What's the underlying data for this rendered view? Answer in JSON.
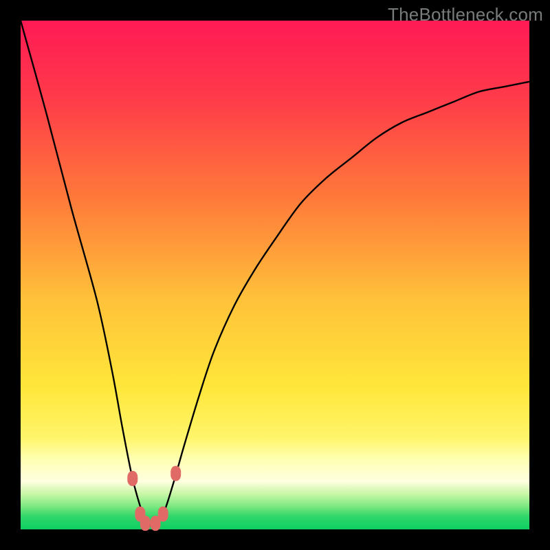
{
  "watermark": "TheBottleneck.com",
  "chart_data": {
    "type": "line",
    "title": "",
    "xlabel": "",
    "ylabel": "",
    "xlim": [
      0,
      100
    ],
    "ylim": [
      0,
      100
    ],
    "series": [
      {
        "name": "bottleneck-curve",
        "x": [
          0,
          5,
          10,
          15,
          18,
          20,
          22,
          24,
          25,
          26,
          28,
          30,
          32,
          35,
          38,
          42,
          46,
          50,
          55,
          60,
          65,
          70,
          75,
          80,
          85,
          90,
          95,
          100
        ],
        "values": [
          100,
          82,
          63,
          45,
          31,
          20,
          10,
          3,
          1,
          1,
          3,
          9,
          16,
          26,
          35,
          44,
          51,
          57,
          64,
          69,
          73,
          77,
          80,
          82,
          84,
          86,
          87,
          88
        ]
      }
    ],
    "markers": [
      {
        "name": "marker-left-upper",
        "x": 22.0,
        "y": 10.0
      },
      {
        "name": "marker-left-lower",
        "x": 23.5,
        "y": 3.0
      },
      {
        "name": "marker-bottom-left",
        "x": 24.5,
        "y": 1.2
      },
      {
        "name": "marker-bottom-right",
        "x": 26.5,
        "y": 1.2
      },
      {
        "name": "marker-right-lower",
        "x": 28.0,
        "y": 3.0
      },
      {
        "name": "marker-right-upper",
        "x": 30.5,
        "y": 11.0
      }
    ],
    "gradient_stops": [
      {
        "pos": 0.0,
        "color": "#ff1a55"
      },
      {
        "pos": 0.15,
        "color": "#ff3a4a"
      },
      {
        "pos": 0.35,
        "color": "#ff7a3a"
      },
      {
        "pos": 0.55,
        "color": "#ffc23a"
      },
      {
        "pos": 0.72,
        "color": "#ffe63a"
      },
      {
        "pos": 0.82,
        "color": "#fff56a"
      },
      {
        "pos": 0.86,
        "color": "#ffffb0"
      },
      {
        "pos": 0.905,
        "color": "#ffffe0"
      },
      {
        "pos": 0.93,
        "color": "#c9f7a8"
      },
      {
        "pos": 0.955,
        "color": "#7be87f"
      },
      {
        "pos": 0.975,
        "color": "#2fd66a"
      },
      {
        "pos": 1.0,
        "color": "#0ecf63"
      }
    ],
    "marker_color": "#e06a66",
    "curve_color": "#000000"
  }
}
